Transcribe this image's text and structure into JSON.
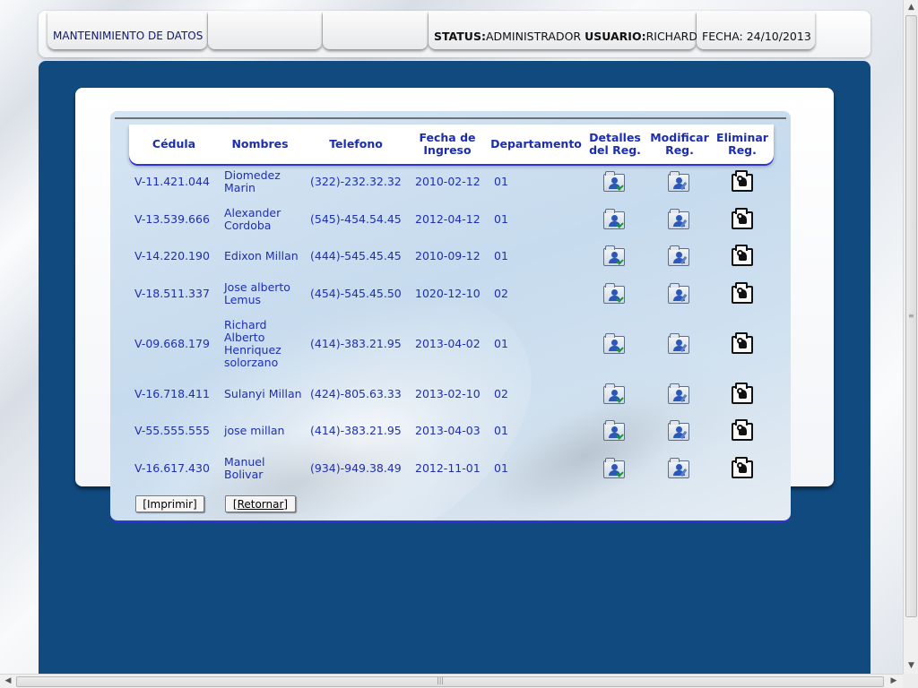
{
  "header": {
    "title": "MANTENIMIENTO DE DATOS",
    "status_label": "STATUS:",
    "status_value": "ADMINISTRADOR",
    "user_label": "USUARIO:",
    "user_value": "RICHARD",
    "date_text": "FECHA: 24/10/2013"
  },
  "table": {
    "columns": {
      "cedula": "Cédula",
      "nombres": "Nombres",
      "telefono": "Telefono",
      "fecha": "Fecha de\nIngreso",
      "departamento": "Departamento",
      "detalles": "Detalles\ndel Reg.",
      "modificar": "Modificar\nReg.",
      "eliminar": "Eliminar\nReg."
    },
    "rows": [
      {
        "cedula": "V-11.421.044",
        "nombres": "Diomedez Marin",
        "telefono": "(322)-232.32.32",
        "fecha": "2010-02-12",
        "departamento": "01"
      },
      {
        "cedula": "V-13.539.666",
        "nombres": "Alexander Cordoba",
        "telefono": "(545)-454.54.45",
        "fecha": "2012-04-12",
        "departamento": "01"
      },
      {
        "cedula": "V-14.220.190",
        "nombres": "Edixon Millan",
        "telefono": "(444)-545.45.45",
        "fecha": "2010-09-12",
        "departamento": "01"
      },
      {
        "cedula": "V-18.511.337",
        "nombres": "Jose alberto Lemus",
        "telefono": "(454)-545.45.50",
        "fecha": "1020-12-10",
        "departamento": "02"
      },
      {
        "cedula": "V-09.668.179",
        "nombres": "Richard Alberto Henriquez solorzano",
        "telefono": "(414)-383.21.95",
        "fecha": "2013-04-02",
        "departamento": "01"
      },
      {
        "cedula": "V-16.718.411",
        "nombres": "Sulanyi Millan",
        "telefono": "(424)-805.63.33",
        "fecha": "2013-02-10",
        "departamento": "02"
      },
      {
        "cedula": "V-55.555.555",
        "nombres": "jose millan",
        "telefono": "(414)-383.21.95",
        "fecha": "2013-04-03",
        "departamento": "01"
      },
      {
        "cedula": "V-16.617.430",
        "nombres": "Manuel Bolivar",
        "telefono": "(934)-949.38.49",
        "fecha": "2012-11-01",
        "departamento": "01"
      }
    ]
  },
  "buttons": {
    "imprimir": "[Imprimir]",
    "retornar": "[Retornar]"
  },
  "icons": {
    "detalles": "folder-details-icon",
    "modificar": "folder-edit-icon",
    "eliminar": "folder-delete-icon"
  },
  "colors": {
    "panel_blue": "#114a7f",
    "text_blue": "#1f2fb0",
    "accent_line": "#2b35d8"
  }
}
